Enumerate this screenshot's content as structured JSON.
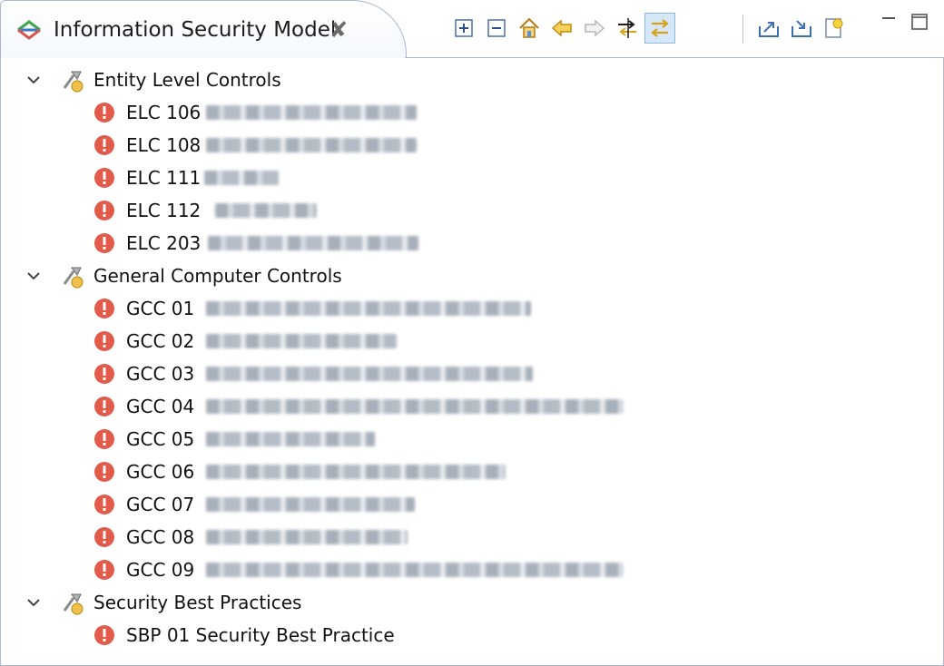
{
  "view": {
    "title": "Information Security Model",
    "close_glyph": "✘",
    "toolbar": [
      {
        "name": "expand-all-icon",
        "tooltip": "Expand All"
      },
      {
        "name": "collapse-all-icon",
        "tooltip": "Collapse All"
      },
      {
        "name": "home-icon",
        "tooltip": "Home"
      },
      {
        "name": "back-arrow-icon",
        "tooltip": "Back"
      },
      {
        "name": "forward-arrow-icon",
        "tooltip": "Forward"
      },
      {
        "name": "link-editor-icon",
        "tooltip": "Link"
      },
      {
        "name": "sync-icon",
        "tooltip": "Sync",
        "active": true
      },
      {
        "name": "export-icon",
        "tooltip": "Export"
      },
      {
        "name": "import-icon",
        "tooltip": "Import"
      },
      {
        "name": "new-item-icon",
        "tooltip": "New"
      }
    ]
  },
  "tree": {
    "groups": [
      {
        "label": "Entity Level Controls",
        "items": [
          {
            "code": "ELC 106"
          },
          {
            "code": "ELC 108"
          },
          {
            "code": "ELC 111"
          },
          {
            "code": "ELC 112"
          },
          {
            "code": "ELC 203"
          }
        ]
      },
      {
        "label": "General Computer Controls",
        "items": [
          {
            "code": "GCC 01"
          },
          {
            "code": "GCC 02"
          },
          {
            "code": "GCC 03"
          },
          {
            "code": "GCC 04"
          },
          {
            "code": "GCC 05"
          },
          {
            "code": "GCC 06"
          },
          {
            "code": "GCC 07"
          },
          {
            "code": "GCC 08"
          },
          {
            "code": "GCC 09"
          }
        ]
      },
      {
        "label": "Security Best Practices",
        "items": [
          {
            "code": "SBP 01 Security Best Practice"
          }
        ]
      }
    ]
  },
  "colors": {
    "error_red": "#e25a4a",
    "border": "#a9b8cc"
  }
}
